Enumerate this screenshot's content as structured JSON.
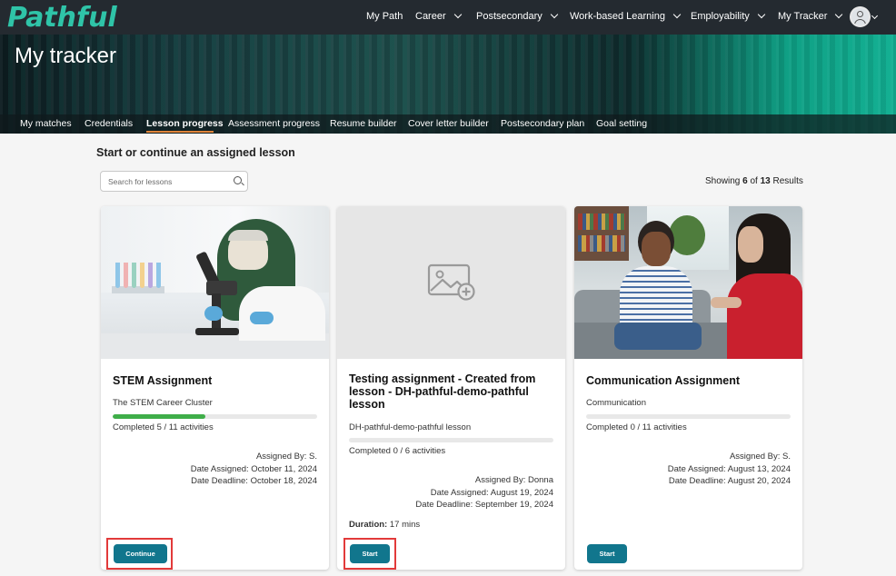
{
  "brand": {
    "logo_text": "Pathful"
  },
  "topnav": {
    "items": [
      {
        "label": "My Path",
        "dropdown": false
      },
      {
        "label": "Career",
        "dropdown": true
      },
      {
        "label": "Postsecondary",
        "dropdown": true
      },
      {
        "label": "Work-based Learning",
        "dropdown": true
      },
      {
        "label": "Employability",
        "dropdown": true
      },
      {
        "label": "My Tracker",
        "dropdown": true
      }
    ]
  },
  "hero": {
    "title": "My tracker"
  },
  "subnav": {
    "items": [
      {
        "label": "My matches",
        "active": false
      },
      {
        "label": "Credentials",
        "active": false
      },
      {
        "label": "Lesson progress",
        "active": true
      },
      {
        "label": "Assessment progress",
        "active": false
      },
      {
        "label": "Resume builder",
        "active": false
      },
      {
        "label": "Cover letter builder",
        "active": false
      },
      {
        "label": "Postsecondary plan",
        "active": false
      },
      {
        "label": "Goal setting",
        "active": false
      }
    ]
  },
  "main": {
    "section_title": "Start or continue an assigned lesson",
    "search_placeholder": "Search for lessons",
    "results": {
      "prefix": "Showing",
      "shown": "6",
      "of": "of",
      "total": "13",
      "suffix": "Results"
    }
  },
  "cards": [
    {
      "title": "STEM Assignment",
      "subtitle": "The STEM Career Cluster",
      "progress": 0.4545,
      "completed": "Completed 5 / 11 activities",
      "assigned_by": "Assigned By: S.",
      "date_assigned": "Date Assigned: October 11, 2024",
      "date_deadline": "Date Deadline: October 18, 2024",
      "button": "Continue",
      "image": "woman-microscope-lab-photo"
    },
    {
      "title": "Testing assignment - Created from lesson - DH-pathful-demo-pathful lesson",
      "subtitle": "DH-pathful-demo-pathful lesson",
      "progress": 0,
      "completed": "Completed 0 / 6 activities",
      "assigned_by": "Assigned By: Donna",
      "date_assigned": "Date Assigned: August 19, 2024",
      "date_deadline": "Date Deadline: September 19, 2024",
      "duration_label": "Duration:",
      "duration_value": "17 mins",
      "button": "Start",
      "image": "image-placeholder-icon"
    },
    {
      "title": "Communication Assignment",
      "subtitle": "Communication",
      "progress": 0,
      "completed": "Completed 0 / 11 activities",
      "assigned_by": "Assigned By: S.",
      "date_assigned": "Date Assigned: August 13, 2024",
      "date_deadline": "Date Deadline: August 20, 2024",
      "button": "Start",
      "image": "two-women-conversation-photo"
    }
  ],
  "colors": {
    "nav_bg": "#242a30",
    "brand": "#2fc4a8",
    "button": "#11768d",
    "progress_fill": "#3fae49",
    "highlight": "#e23a3a",
    "active_underline": "#e0843a"
  }
}
